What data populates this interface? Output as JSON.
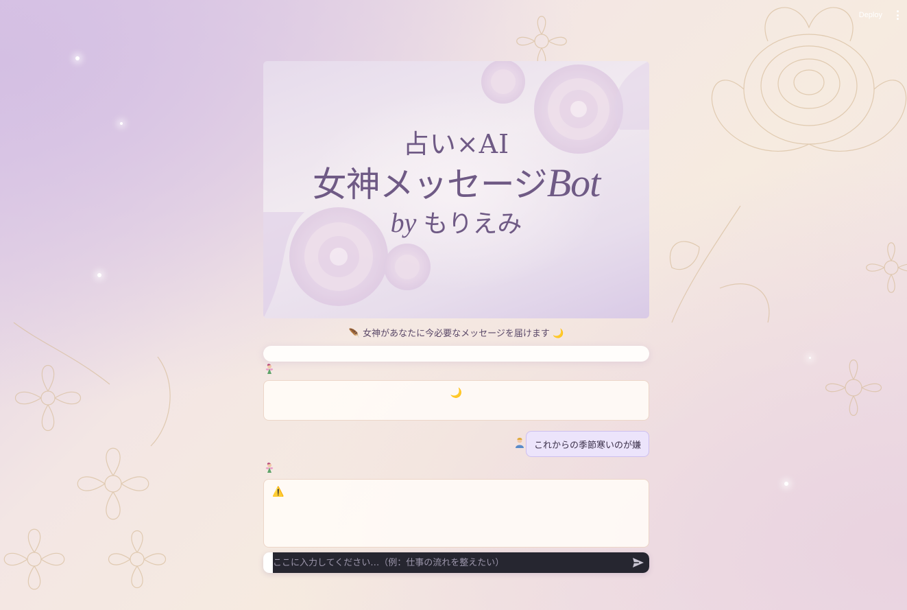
{
  "topbar": {
    "deploy_label": "Deploy",
    "menu_icon": "more-vert-icon"
  },
  "hero": {
    "line1": "占い×AI",
    "line2_main": "女神メッセージ",
    "line2_accent": "Bot",
    "line3_by": "by",
    "line3_name": "もりえみ"
  },
  "tagline": {
    "lead_icon": "🪶",
    "text": "女神があなたに今必要なメッセージを届けます",
    "trail_icon": "🌙"
  },
  "chat": {
    "bot_avatar_icon": "fairy-icon",
    "user_avatar_icon": "person-icon",
    "messages": [
      {
        "role": "assistant",
        "icon": "🌙"
      },
      {
        "role": "user",
        "text": "これからの季節寒いのが嫌"
      },
      {
        "role": "assistant",
        "icon": "⚠️"
      }
    ]
  },
  "input": {
    "placeholder": "ここに入力してください…（例：仕事の流れを整えたい）",
    "value": "",
    "send_icon": "send-icon"
  },
  "colors": {
    "title_purple": "#6f5a85",
    "user_bubble": "#ece4fb",
    "bot_box_border": "#ecd6c8",
    "input_dark": "#262630"
  }
}
